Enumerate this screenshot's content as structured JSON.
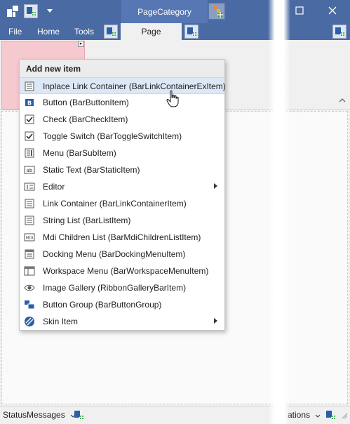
{
  "titlebar": {
    "page_category": "PageCategory",
    "menu_tabs": [
      "File",
      "Home",
      "Tools"
    ],
    "active_tab": "Page"
  },
  "popup": {
    "title": "Add new item",
    "items": [
      {
        "label": "Inplace Link Container (BarLinkContainerExItem)",
        "icon": "list-icon",
        "submenu": false,
        "hovered": true
      },
      {
        "label": "Button (BarButtonItem)",
        "icon": "button-icon",
        "submenu": false
      },
      {
        "label": "Check (BarCheckItem)",
        "icon": "checkbox-icon",
        "submenu": false
      },
      {
        "label": "Toggle Switch (BarToggleSwitchItem)",
        "icon": "checkbox-icon",
        "submenu": false
      },
      {
        "label": "Menu (BarSubItem)",
        "icon": "submenu-icon",
        "submenu": false
      },
      {
        "label": "Static Text (BarStaticItem)",
        "icon": "static-text-icon",
        "submenu": false
      },
      {
        "label": "Editor",
        "icon": "editor-icon",
        "submenu": true
      },
      {
        "label": "Link Container (BarLinkContainerItem)",
        "icon": "list-icon",
        "submenu": false
      },
      {
        "label": "String List (BarListItem)",
        "icon": "list-icon",
        "submenu": false
      },
      {
        "label": "Mdi Children List (BarMdiChildrenListItem)",
        "icon": "mdi-icon",
        "submenu": false
      },
      {
        "label": "Docking Menu (BarDockingMenuItem)",
        "icon": "docking-icon",
        "submenu": false
      },
      {
        "label": "Workspace Menu (BarWorkspaceMenuItem)",
        "icon": "workspace-icon",
        "submenu": false
      },
      {
        "label": "Image Gallery (RibbonGalleryBarItem)",
        "icon": "eye-icon",
        "submenu": false
      },
      {
        "label": "Button Group (BarButtonGroup)",
        "icon": "button-group-icon",
        "submenu": false
      },
      {
        "label": "Skin Item",
        "icon": "skin-icon",
        "submenu": true
      }
    ]
  },
  "statusbar": {
    "left_label": "StatusMessages",
    "right_label": "ations"
  },
  "colors": {
    "titlebar": "#4a6aa3",
    "hover": "#dde8f7",
    "pink_group": "#f6c9cf",
    "icon_blue": "#2a5fa8"
  }
}
